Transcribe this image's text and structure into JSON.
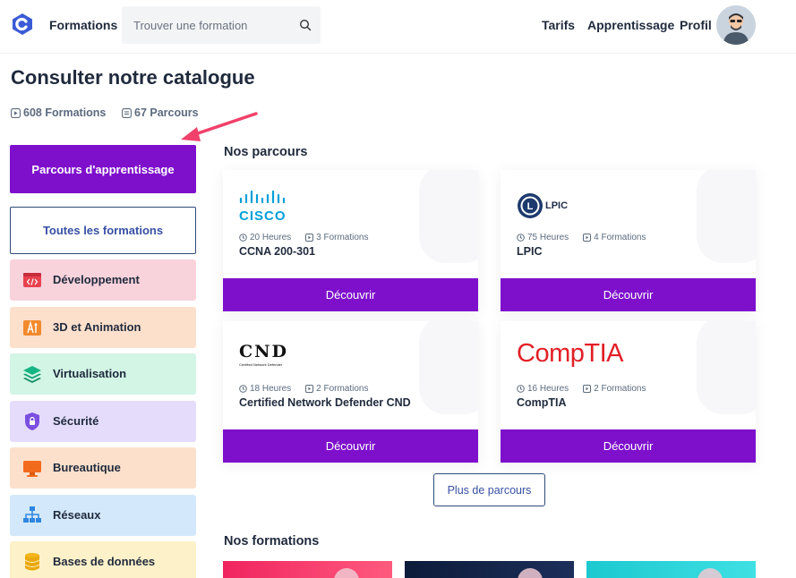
{
  "header": {
    "nav_formations": "Formations",
    "search_placeholder": "Trouver une formation",
    "nav_tarifs": "Tarifs",
    "nav_apprentissage": "Apprentissage",
    "nav_profil": "Profil"
  },
  "page": {
    "title": "Consulter notre catalogue",
    "stat_formations": "608 Formations",
    "stat_parcours": "67 Parcours"
  },
  "sidebar": {
    "parcours_button": "Parcours d'apprentissage",
    "toutes_button": "Toutes les formations",
    "categories": [
      {
        "label": "Développement",
        "icon": "code-window-icon",
        "color": "#f9d3dc"
      },
      {
        "label": "3D et Animation",
        "icon": "3d-tools-icon",
        "color": "#fde0cc"
      },
      {
        "label": "Virtualisation",
        "icon": "layers-icon",
        "color": "#d2f5e5"
      },
      {
        "label": "Sécurité",
        "icon": "shield-lock-icon",
        "color": "#e5dcfb"
      },
      {
        "label": "Bureautique",
        "icon": "monitor-icon",
        "color": "#fde0cc"
      },
      {
        "label": "Réseaux",
        "icon": "network-icon",
        "color": "#d3e9fb"
      },
      {
        "label": "Bases de données",
        "icon": "database-icon",
        "color": "#fdf1c9"
      }
    ]
  },
  "main": {
    "parcours_title": "Nos parcours",
    "formations_title": "Nos formations",
    "more_button": "Plus de parcours",
    "cards": [
      {
        "logo_text": "CISCO",
        "hours": "20 Heures",
        "count": "3 Formations",
        "name": "CCNA 200-301",
        "button": "Découvrir"
      },
      {
        "logo_text": "LPIC",
        "hours": "75 Heures",
        "count": "4 Formations",
        "name": "LPIC",
        "button": "Découvrir"
      },
      {
        "logo_text": "CND",
        "logo_sub": "Certified Network Defender",
        "hours": "18 Heures",
        "count": "2 Formations",
        "name": "Certified Network Defender CND",
        "button": "Découvrir"
      },
      {
        "logo_text": "CompTIA",
        "hours": "16 Heures",
        "count": "2 Formations",
        "name": "CompTIA",
        "button": "Découvrir"
      }
    ]
  },
  "colors": {
    "primary": "#7e10cc",
    "brand": "#3b5bd6",
    "arrow": "#f0416b",
    "cisco": "#049fd9",
    "comptia": "#e21f26"
  }
}
